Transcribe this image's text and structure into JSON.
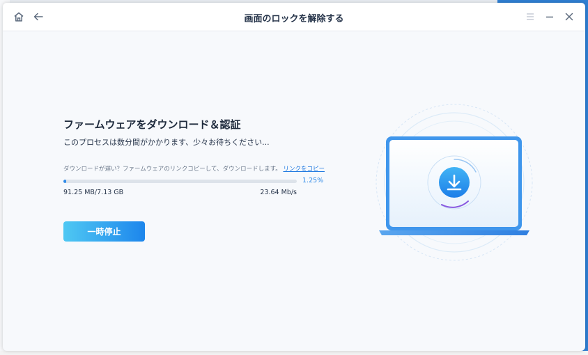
{
  "window": {
    "title": "画面のロックを解除する"
  },
  "content": {
    "heading": "ファームウェアをダウンロード＆認証",
    "subtitle": "このプロセスは数分間がかかります、少々お待ちください...",
    "hint_text": "ダウンロードが遅い？ファームウェアのリンクコピーして、ダウンロードします。",
    "copy_link_label": "リンクをコピー",
    "progress_percent_label": "1.25%",
    "progress_fraction": 0.0125,
    "downloaded_size": "91.25 MB/7.13 GB",
    "download_speed": "23.64 Mb/s",
    "pause_button_label": "一時停止"
  },
  "icons": {
    "home": "home-icon",
    "back": "arrow-left-icon",
    "menu": "menu-icon",
    "minimize": "minimize-icon",
    "close": "close-icon",
    "download": "download-icon",
    "laptop": "laptop-illustration"
  },
  "colors": {
    "accent": "#2f8ae8",
    "button_gradient_start": "#4fc8f3",
    "button_gradient_end": "#1d86ec",
    "link": "#1e78e0",
    "text_dark": "#1f2b3d"
  }
}
